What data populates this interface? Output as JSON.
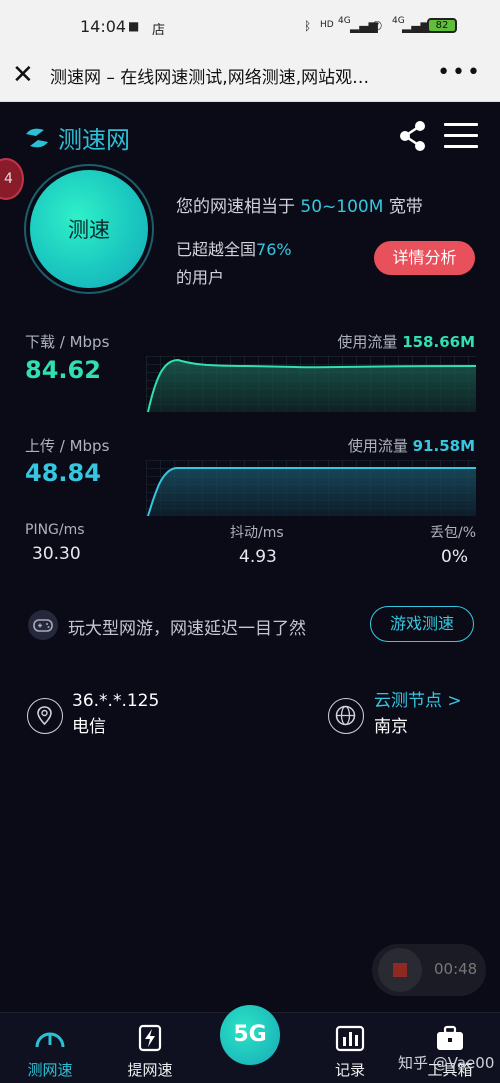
{
  "status_bar": {
    "time": "14:04",
    "store_icon_text": "店",
    "hd": "HD",
    "net1": "4G",
    "net2": "4G",
    "battery": "82"
  },
  "browser": {
    "title": "测速网 – 在线网速测试,网络测速,网站观…"
  },
  "app": {
    "logo_text": "测速网",
    "accent": "#2cc0d6"
  },
  "test": {
    "badge_count": "4",
    "button_label": "测速",
    "summary_prefix": "您的网速相当于",
    "summary_band": "50~100M",
    "summary_suffix": "宽带",
    "beat_prefix": "已超越全国",
    "beat_percent": "76%",
    "beat_suffix": "的用户",
    "detail_button": "详情分析"
  },
  "download": {
    "label": "下载 / Mbps",
    "value": "84.62",
    "usage_label": "使用流量",
    "usage_value": "158.66M",
    "color": "#30e0b0"
  },
  "upload": {
    "label": "上传 / Mbps",
    "value": "48.84",
    "usage_label": "使用流量",
    "usage_value": "91.58M",
    "color": "#36c7e0"
  },
  "stats": {
    "ping_label": "PING/ms",
    "ping_value": "30.30",
    "jitter_label": "抖动/ms",
    "jitter_value": "4.93",
    "loss_label": "丢包/%",
    "loss_value": "0%"
  },
  "game": {
    "text": "玩大型网游，网速延迟一目了然",
    "button": "游戏测速"
  },
  "connection": {
    "ip": "36.*.*.125",
    "isp": "电信",
    "node_label": "云测节点 >",
    "node_city": "南京"
  },
  "recorder": {
    "time": "00:48"
  },
  "nav": {
    "items": [
      {
        "label": "测网速"
      },
      {
        "label": "提网速"
      },
      {
        "label": "5G"
      },
      {
        "label": "记录"
      },
      {
        "label": "工具箱"
      }
    ],
    "watermark": "知乎 @Vae00"
  }
}
